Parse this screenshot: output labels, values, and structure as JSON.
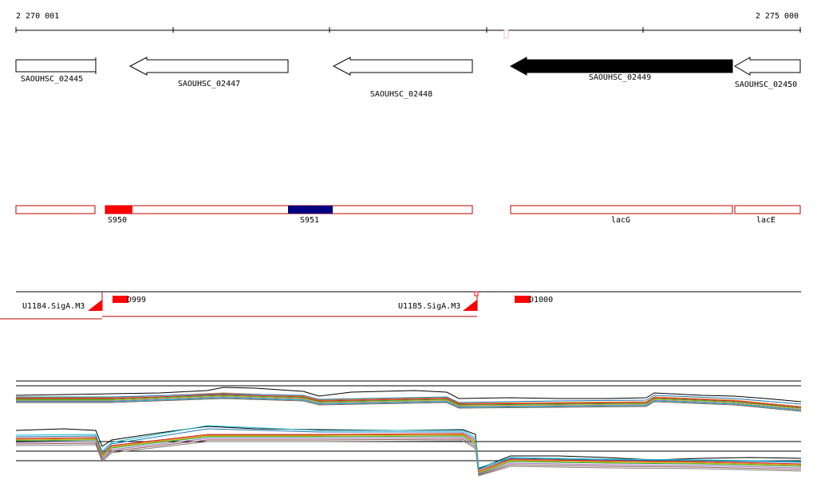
{
  "ruler": {
    "start_label": "2 270 001",
    "end_label": "2 275 000"
  },
  "genes": [
    {
      "name": "SAOUHSC_02445",
      "strand": "-",
      "highlighted": false
    },
    {
      "name": "SAOUHSC_02447",
      "strand": "-",
      "highlighted": false
    },
    {
      "name": "SAOUHSC_02448",
      "strand": "-",
      "highlighted": false
    },
    {
      "name": "SAOUHSC_02449",
      "strand": "-",
      "highlighted": true
    },
    {
      "name": "SAOUHSC_02450",
      "strand": "-",
      "highlighted": false
    }
  ],
  "annotation_track": {
    "features": [
      {
        "name": "S950",
        "color": "#ff0000"
      },
      {
        "name": "S951",
        "color": "#000080"
      }
    ],
    "operon_labels": [
      "lacG",
      "lacE"
    ]
  },
  "regulatory_track": {
    "promoters": [
      "U1184.SigA.M3",
      "U1185.SigA.M3"
    ],
    "sites": [
      "D999",
      "D1000"
    ]
  },
  "colors": {
    "outline": "#c00000",
    "highlight_gene": "#000000",
    "feature_red": "#ff0000",
    "feature_blue": "#000080"
  }
}
